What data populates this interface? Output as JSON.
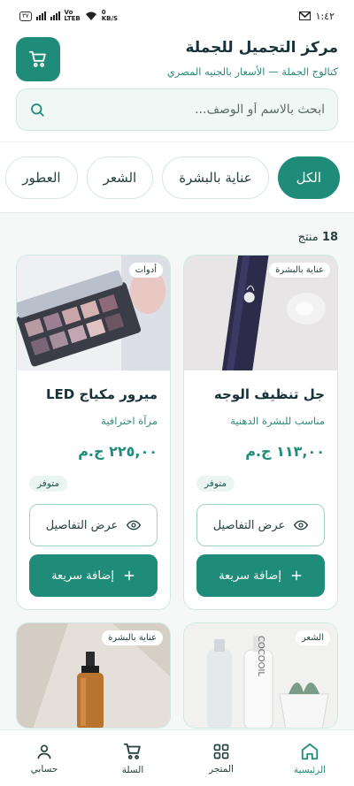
{
  "status": {
    "time": "١:٤٢",
    "left_badge": "٣٧",
    "network_top": "Vo",
    "network_bottom": "LTEB",
    "speed_top": "0",
    "speed_bottom": "KB/S"
  },
  "header": {
    "title": "مركز التجميل للجملة",
    "subtitle": "كتالوج الجملة — الأسعار بالجنيه المصري"
  },
  "search": {
    "placeholder": "ابحث بالاسم أو الوصف..."
  },
  "categories": [
    "الكل",
    "عناية بالبشرة",
    "الشعر",
    "العطور"
  ],
  "count": {
    "number": "18",
    "label": "منتج"
  },
  "products": [
    {
      "badge": "عناية بالبشرة",
      "name": "جل تنظيف الوجه",
      "desc": "مناسب للبشرة الدهنية",
      "price": "١١٣,٠٠ ج.م",
      "stock": "متوفر",
      "details_label": "عرض التفاصيل",
      "add_label": "إضافة سريعة"
    },
    {
      "badge": "أدوات",
      "name": "ميرور مكياج LED",
      "desc": "مرآة احترافية",
      "price": "٢٢٥,٠٠ ج.م",
      "stock": "متوفر",
      "details_label": "عرض التفاصيل",
      "add_label": "إضافة سريعة"
    },
    {
      "badge": "الشعر",
      "bottle_text": "COCOOIL"
    },
    {
      "badge": "عناية بالبشرة"
    }
  ],
  "nav": {
    "home": "الرئيسية",
    "store": "المتجر",
    "cart": "السلة",
    "account": "حسابي"
  },
  "colors": {
    "primary": "#1f8c79",
    "accent_text": "#2a8a7b"
  }
}
